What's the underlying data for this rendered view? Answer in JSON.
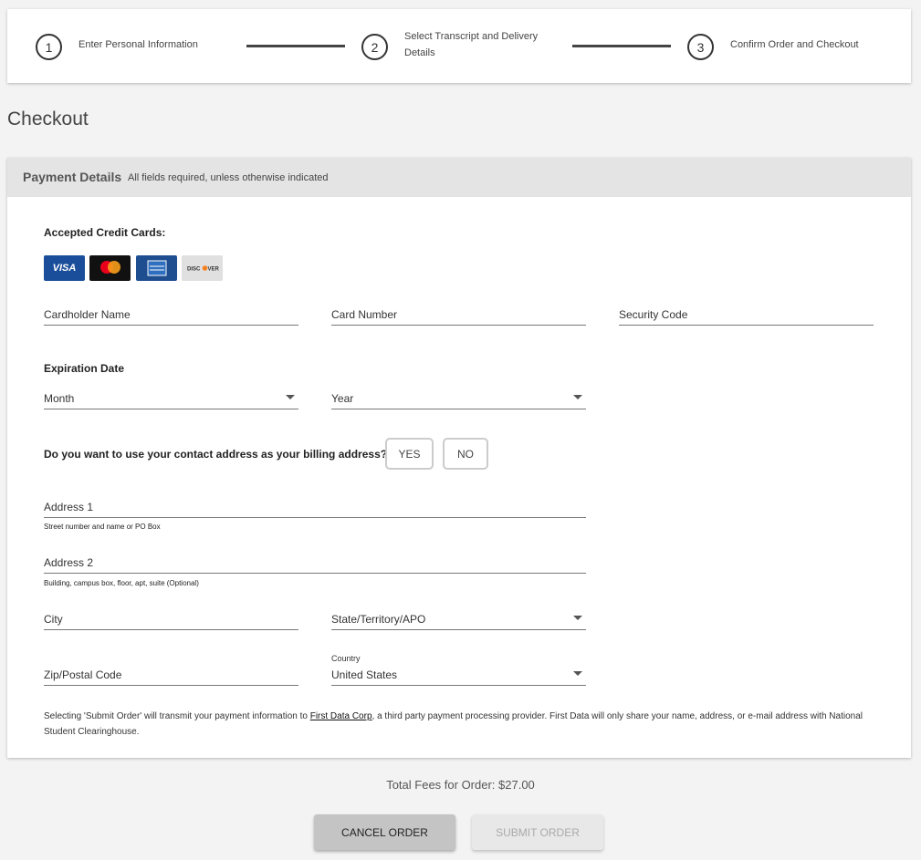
{
  "stepper": {
    "steps": [
      {
        "number": "1",
        "label": "Enter Personal Information"
      },
      {
        "number": "2",
        "label_line1": "Select Transcript and Delivery",
        "label_line2": "Details"
      },
      {
        "number": "3",
        "label": "Confirm Order and Checkout"
      }
    ]
  },
  "page_title": "Checkout",
  "payment": {
    "header_title": "Payment Details",
    "header_note": "All fields required, unless otherwise indicated",
    "accepted_cards_label": "Accepted Credit Cards:",
    "cards": [
      {
        "name": "visa-card-icon",
        "text": "VISA"
      },
      {
        "name": "mastercard-card-icon",
        "text": "mastercard"
      },
      {
        "name": "amex-card-icon",
        "text": "AMERICAN EXPRESS"
      },
      {
        "name": "discover-card-icon",
        "text": "DISCOVER"
      }
    ],
    "cardholder_name": "Cardholder Name",
    "card_number": "Card Number",
    "security_code": "Security Code",
    "expiration_label": "Expiration Date",
    "month": "Month",
    "year": "Year",
    "billing_question": "Do you want to use your contact address as your billing address?",
    "yes": "YES",
    "no": "NO",
    "address1": "Address 1",
    "address1_hint": "Street number and name or PO Box",
    "address2": "Address 2",
    "address2_hint": "Building, campus box, floor, apt, suite (Optional)",
    "city": "City",
    "state": "State/Territory/APO",
    "zip": "Zip/Postal Code",
    "country_label": "Country",
    "country_value": "United States",
    "disclaimer_before": "Selecting 'Submit Order' will transmit your payment information to ",
    "disclaimer_link": "First Data Corp",
    "disclaimer_after": ", a third party payment processing provider. First Data will only share your name, address, or e-mail address with National Student Clearinghouse."
  },
  "total": "Total Fees for Order: $27.00",
  "buttons": {
    "cancel": "CANCEL ORDER",
    "submit": "SUBMIT ORDER"
  },
  "colors": {
    "background": "#f3f3f3",
    "header_bar": "#e4e4e4",
    "visa": "#1a4e9a",
    "amex": "#1e4e8f",
    "mastercard_red": "#eb001b",
    "mastercard_orange": "#f79e1b",
    "discover_orange": "#f58220"
  }
}
